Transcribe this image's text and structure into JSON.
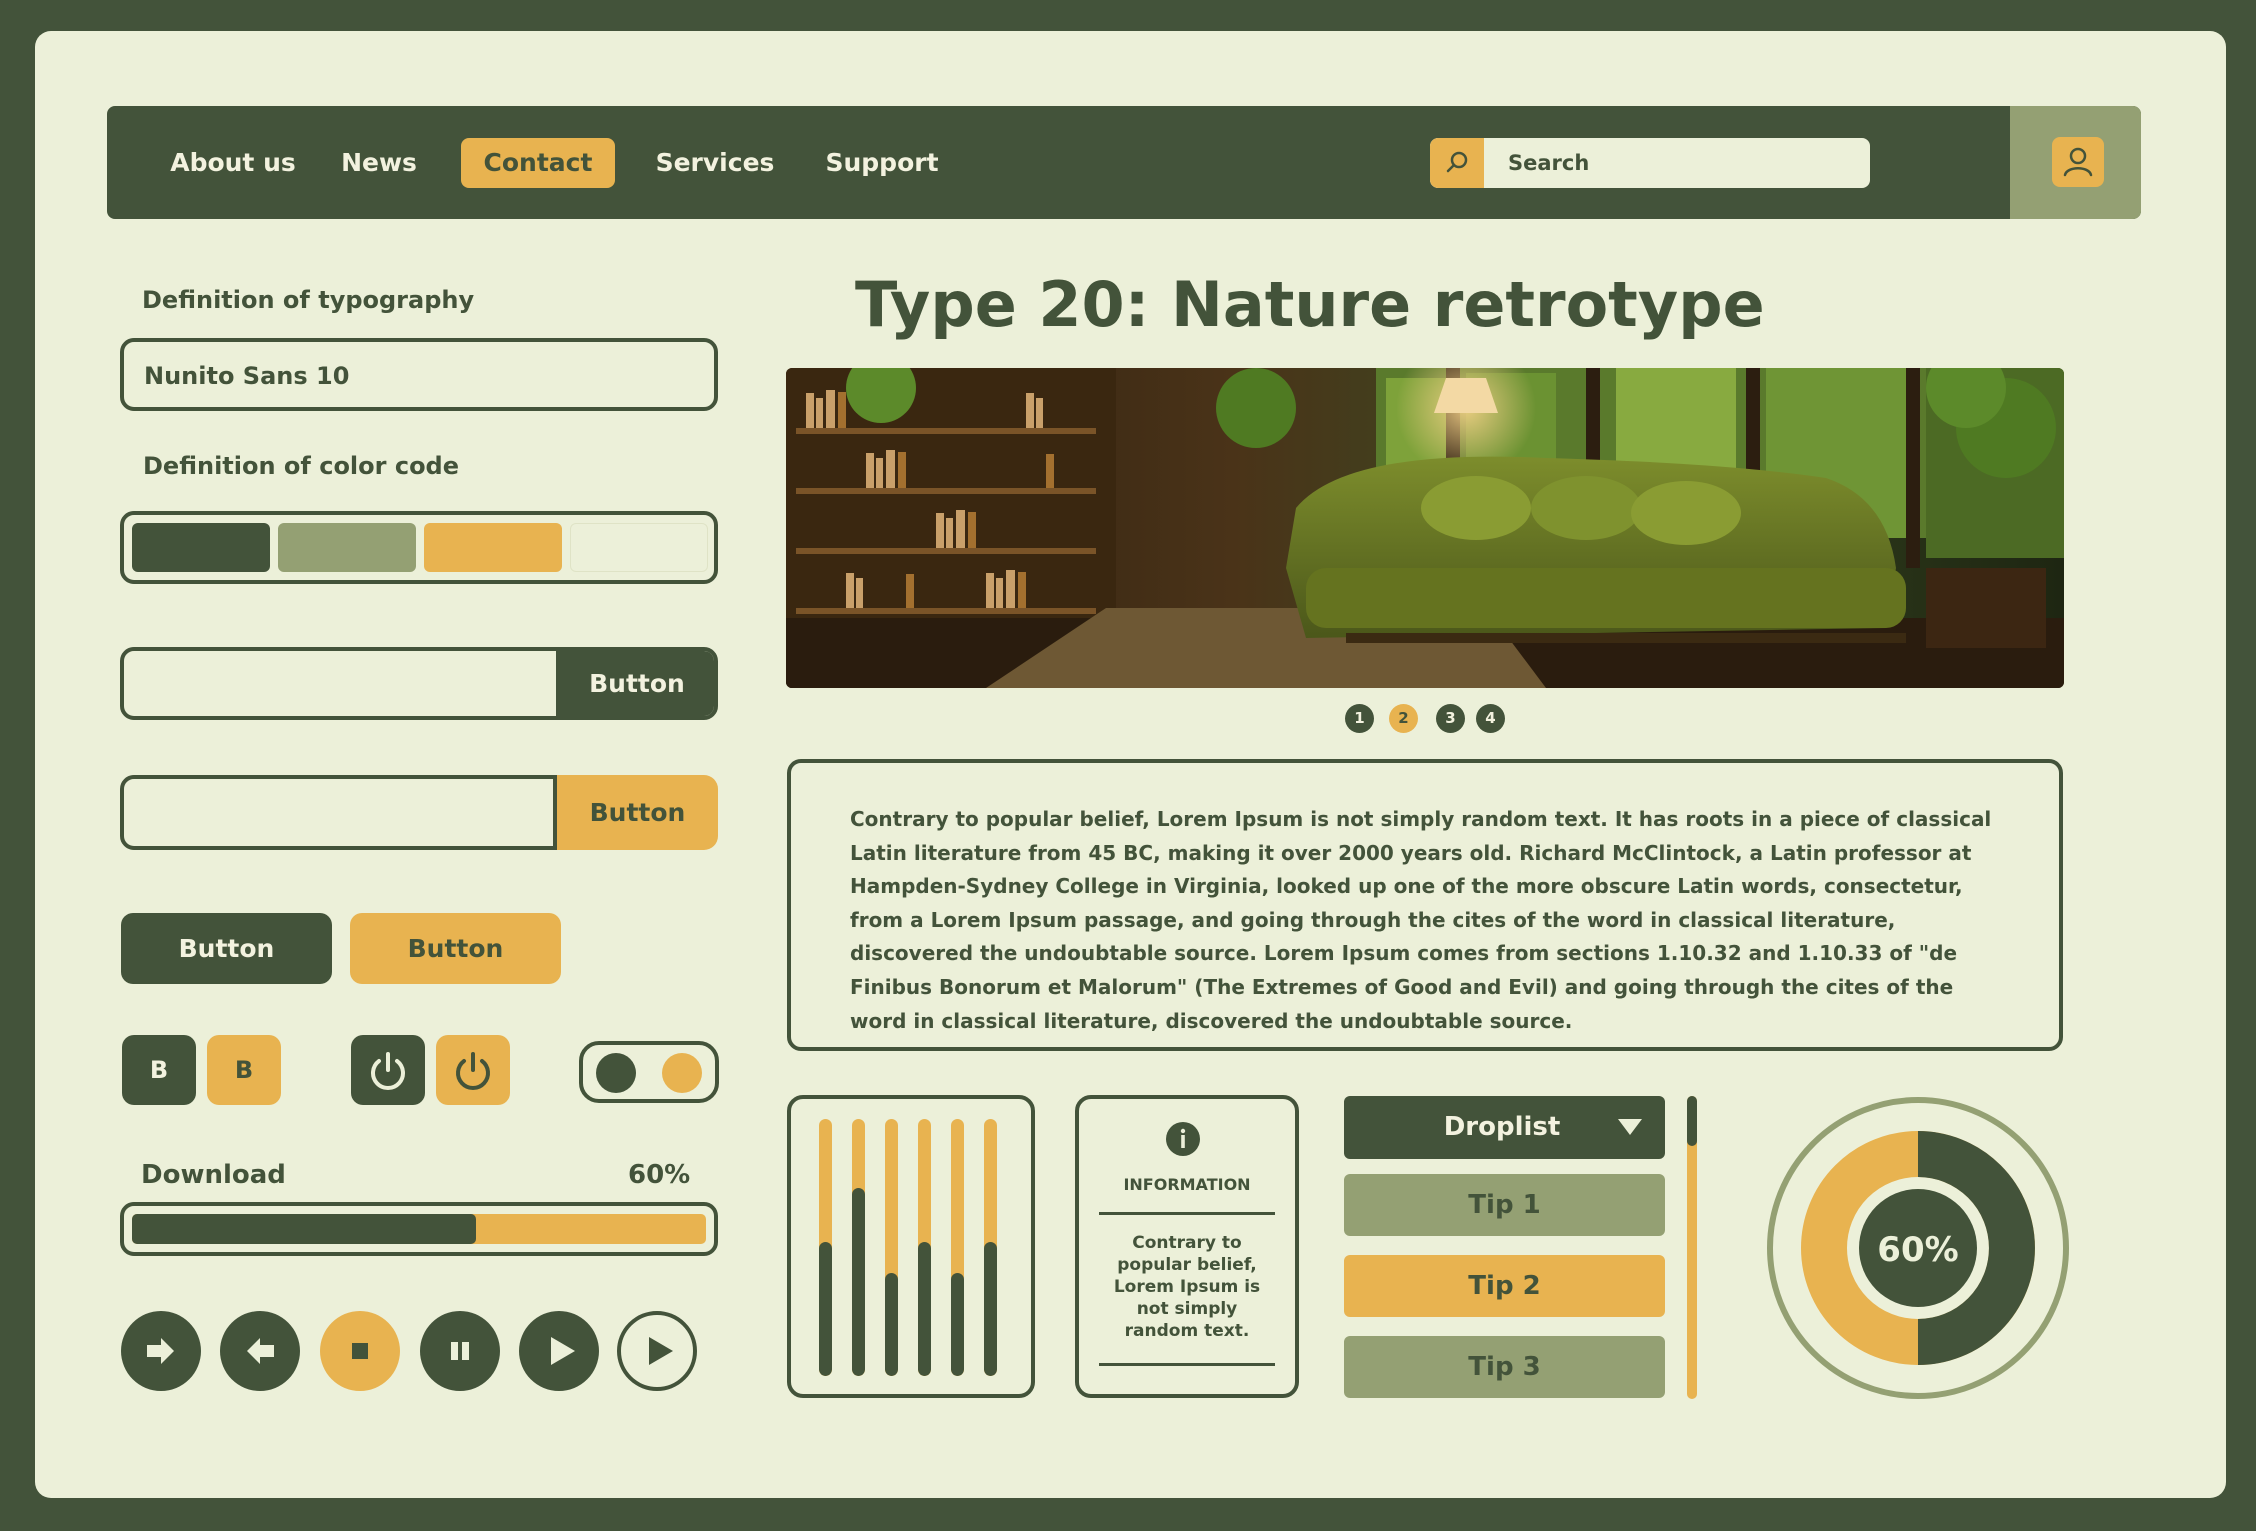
{
  "colors": {
    "dark_green": "#43533a",
    "sage": "#94a073",
    "mustard": "#e8b350",
    "cream": "#ecf0d9"
  },
  "nav": {
    "items": [
      {
        "label": "About us"
      },
      {
        "label": "News"
      },
      {
        "label": "Contact",
        "active": true
      },
      {
        "label": "Services"
      },
      {
        "label": "Support"
      }
    ],
    "search_placeholder": "Search",
    "search_icon": "search-icon",
    "user_icon": "user-icon"
  },
  "typography": {
    "label": "Definition of typography",
    "value": "Nunito Sans 10"
  },
  "color_code": {
    "label": "Definition of color code",
    "swatches": [
      "#43533a",
      "#94a073",
      "#e8b350",
      "#ecf0d9"
    ]
  },
  "buttons": {
    "input_button_dark": "Button",
    "input_button_yellow": "Button",
    "button_dark": "Button",
    "button_yellow": "Button",
    "bold_dark": "B",
    "bold_yellow": "B"
  },
  "download": {
    "label": "Download",
    "percent_text": "60%",
    "progress": 0.6
  },
  "media_controls": [
    "forward-arrow-icon",
    "back-arrow-icon",
    "stop-icon",
    "pause-icon",
    "play-icon",
    "play-outline-icon"
  ],
  "hero": {
    "title": "Type 20: Nature retrotype",
    "pagination": [
      "1",
      "2",
      "3",
      "4"
    ],
    "active_page": "2"
  },
  "paragraph": "Contrary to popular belief, Lorem Ipsum is not simply random text. It has roots in a piece of classical Latin literature from 45 BC, making it over 2000 years old. Richard McClintock, a Latin professor at Hampden-Sydney College in Virginia, looked up one of the more obscure Latin words, consectetur, from a Lorem Ipsum passage, and going through the cites of the word in classical literature, discovered the undoubtable source. Lorem Ipsum comes from sections 1.10.32 and 1.10.33 of \"de Finibus Bonorum et Malorum\" (The Extremes of Good and Evil) and going through the cites of the word in classical literature, discovered the undoubtable source.",
  "equalizer": {
    "levels": [
      0.52,
      0.73,
      0.4,
      0.52,
      0.4,
      0.52
    ]
  },
  "info_card": {
    "icon": "info-icon",
    "heading": "INFORMATION",
    "body": "Contrary to popular belief, Lorem Ipsum is not simply random text."
  },
  "droplist": {
    "label": "Droplist",
    "options": [
      "Tip 1",
      "Tip 2",
      "Tip 3"
    ],
    "highlighted": "Tip 2"
  },
  "donut": {
    "label": "60%",
    "value": 0.5
  }
}
